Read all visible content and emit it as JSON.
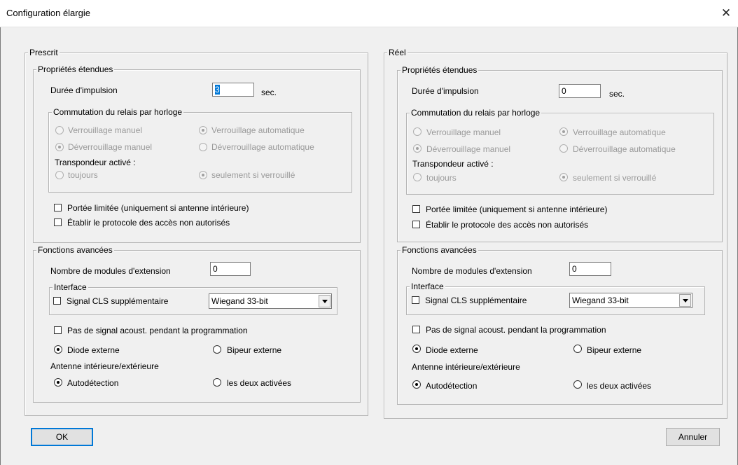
{
  "window": {
    "title": "Configuration élargie",
    "close_glyph": "✕"
  },
  "labels": {
    "props": "Propriétés étendues",
    "pulse": "Durée d'impulsion",
    "sec": "sec.",
    "clock": "Commutation du relais par horloge",
    "manual_lock": "Verrouillage manuel",
    "auto_lock": "Verrouillage automatique",
    "manual_unlock": "Déverrouillage manuel",
    "auto_unlock": "Déverrouillage automatique",
    "transponder": "Transpondeur activé :",
    "always": "toujours",
    "only_locked": "seulement si verrouillé",
    "limited_range": "Portée limitée (uniquement si antenne intérieure)",
    "protocol": "Établir le protocole des accès non autorisés",
    "advanced": "Fonctions avancées",
    "modules": "Nombre de modules d'extension",
    "interface": "Interface",
    "cls_signal": "Signal CLS supplémentaire",
    "no_beep": "Pas de signal acoust. pendant la programmation",
    "ext_diode": "Diode externe",
    "ext_buzzer": "Bipeur externe",
    "antenna": "Antenne intérieure/extérieure",
    "autodetect": "Autodétection",
    "both_active": "les deux activées"
  },
  "left": {
    "title": "Prescrit",
    "pulse_value": "3",
    "modules_value": "0",
    "interface_value": "Wiegand 33-bit"
  },
  "right": {
    "title": "Réel",
    "pulse_value": "0",
    "modules_value": "0",
    "interface_value": "Wiegand 33-bit"
  },
  "buttons": {
    "ok": "OK",
    "cancel": "Annuler"
  }
}
